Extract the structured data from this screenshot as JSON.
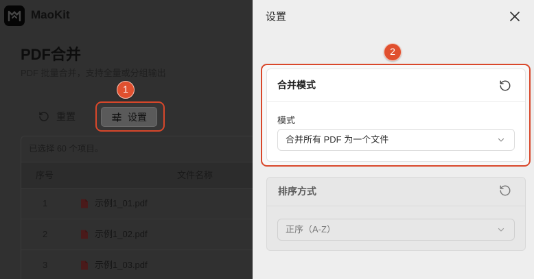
{
  "app": {
    "name": "MaoKit",
    "logo_icon": "maokit-logo-icon"
  },
  "page": {
    "title": "PDF合并",
    "subtitle": "PDF 批量合并，支持全量或分组输出"
  },
  "toolbar": {
    "reset_label": "重置",
    "reset_icon": "rotate-ccw-icon",
    "settings_label": "设置",
    "settings_icon": "sliders-icon"
  },
  "selection": {
    "summary": "已选择 60 个项目。"
  },
  "table": {
    "columns": {
      "index": "序号",
      "name": "文件名称"
    },
    "rows": [
      {
        "index": "1",
        "name": "示例1_01.pdf",
        "icon": "pdf-file-icon"
      },
      {
        "index": "2",
        "name": "示例1_02.pdf",
        "icon": "pdf-file-icon"
      },
      {
        "index": "3",
        "name": "示例1_03.pdf",
        "icon": "pdf-file-icon"
      }
    ]
  },
  "settings_panel": {
    "title": "设置",
    "close_icon": "close-icon",
    "sections": [
      {
        "title": "合并模式",
        "reset_icon": "rotate-ccw-icon",
        "field_label": "模式",
        "selected": "合并所有 PDF 为一个文件",
        "dropdown_icon": "chevron-down-icon"
      },
      {
        "title": "排序方式",
        "reset_icon": "rotate-ccw-icon",
        "selected": "正序（A-Z）",
        "dropdown_icon": "chevron-down-icon"
      }
    ]
  },
  "annotations": [
    {
      "label": "1"
    },
    {
      "label": "2"
    }
  ],
  "colors": {
    "annotation_red": "#e0502f",
    "highlight_outline": "#d9472a",
    "dimmed_page": "#303030",
    "panel_background": "#eeeeee",
    "card_background": "#ffffff",
    "pdf_icon": "#4a1a1a"
  }
}
